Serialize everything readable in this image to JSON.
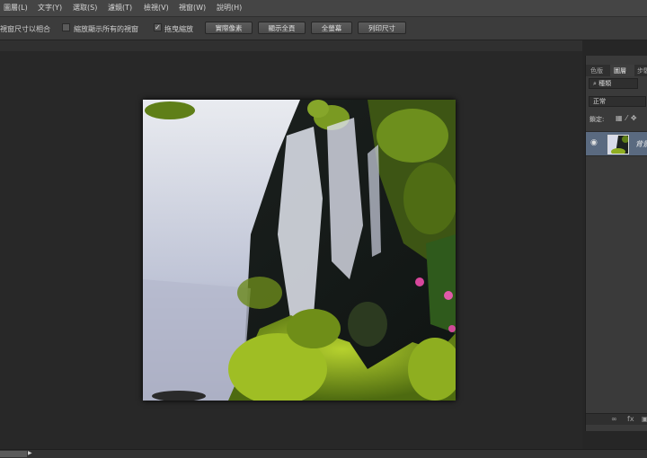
{
  "menubar": {
    "items": [
      "圖層(L)",
      "文字(Y)",
      "選取(S)",
      "濾鏡(T)",
      "檢視(V)",
      "視窗(W)",
      "說明(H)"
    ]
  },
  "options_bar": {
    "fit_windows_label": "視窗尺寸以相合",
    "zoom_all_label": "縮放顯示所有的視窗",
    "zoom_all_checked": false,
    "scrubby_zoom_label": "拖曳縮放",
    "scrubby_zoom_checked": true,
    "actual_pixels_button": "實際像素",
    "fit_screen_button": "顯示全頁",
    "fill_screen_button": "全螢幕",
    "print_size_button": "列印尺寸"
  },
  "panel": {
    "tabs": [
      "色版",
      "圖層",
      "步驟"
    ],
    "active_tab": "圖層",
    "kind_filter": "種類",
    "blend_mode": "正常",
    "lock_label": "鎖定:",
    "layer": {
      "name": "背景",
      "visible": true
    }
  },
  "colors": {
    "menubar": "#454545",
    "canvas_bg": "#282828",
    "panel_bg": "#3a3a3a",
    "selected_layer": "#5a6a80"
  },
  "icons": {
    "visibility": "eye-icon",
    "lock_pixels": "lock-pixels-icon",
    "lock_brush": "brush-icon",
    "lock_move": "move-icon",
    "search": "search-icon",
    "link": "link-icon",
    "fx": "fx-icon",
    "new_layer": "new-layer-icon"
  }
}
